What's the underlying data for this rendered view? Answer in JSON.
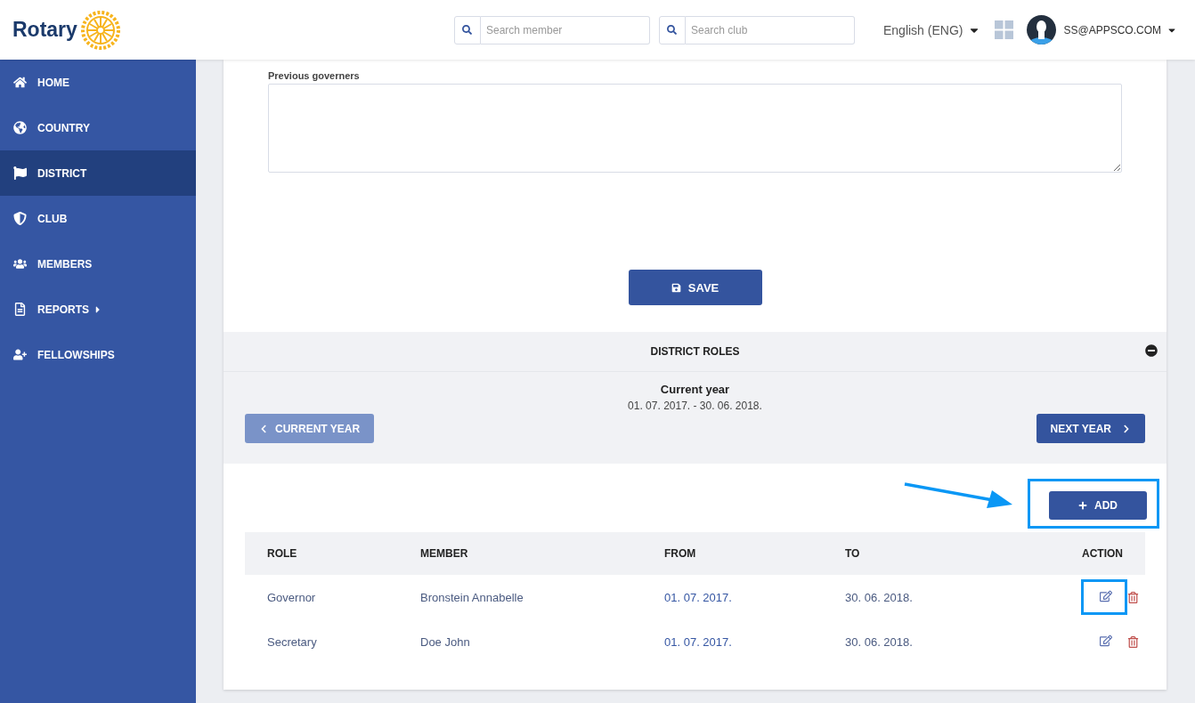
{
  "header": {
    "logo": "Rotary",
    "search_member": {
      "placeholder": "Search member"
    },
    "search_club": {
      "placeholder": "Search club"
    },
    "language": "English (ENG)",
    "user": "SS@APPSCO.COM"
  },
  "sidebar": {
    "items": [
      {
        "label": "HOME",
        "kind": "home",
        "selected": false,
        "submenu": false
      },
      {
        "label": "COUNTRY",
        "kind": "globe",
        "selected": false,
        "submenu": false
      },
      {
        "label": "DISTRICT",
        "kind": "flag",
        "selected": true,
        "submenu": false
      },
      {
        "label": "CLUB",
        "kind": "shield",
        "selected": false,
        "submenu": false
      },
      {
        "label": "MEMBERS",
        "kind": "users",
        "selected": false,
        "submenu": false
      },
      {
        "label": "REPORTS",
        "kind": "file",
        "selected": false,
        "submenu": true
      },
      {
        "label": "FELLOWSHIPS",
        "kind": "user-plus",
        "selected": false,
        "submenu": false
      }
    ]
  },
  "form": {
    "previous_governors": {
      "label": "Previous governers"
    },
    "save_button": "SAVE"
  },
  "district_roles": {
    "title": "DISTRICT ROLES",
    "expanded": true,
    "period_title": "Current year",
    "period": "01. 07. 2017. - 30. 06. 2018.",
    "prev_button": {
      "label": "CURRENT YEAR",
      "disabled": true
    },
    "next_button": {
      "label": "NEXT YEAR",
      "disabled": false
    },
    "add_button": {
      "label": "ADD",
      "highlighted": true
    },
    "table": {
      "columns": [
        "ROLE",
        "MEMBER",
        "FROM",
        "TO",
        "ACTION"
      ],
      "rows": [
        {
          "role": "Governor",
          "member": "Bronstein Annabelle",
          "from": "01. 07. 2017.",
          "to": "30. 06. 2018.",
          "edit_highlighted": true
        },
        {
          "role": "Secretary",
          "member": "Doe John",
          "from": "01. 07. 2017.",
          "to": "30. 06. 2018.",
          "edit_highlighted": false
        }
      ]
    }
  }
}
